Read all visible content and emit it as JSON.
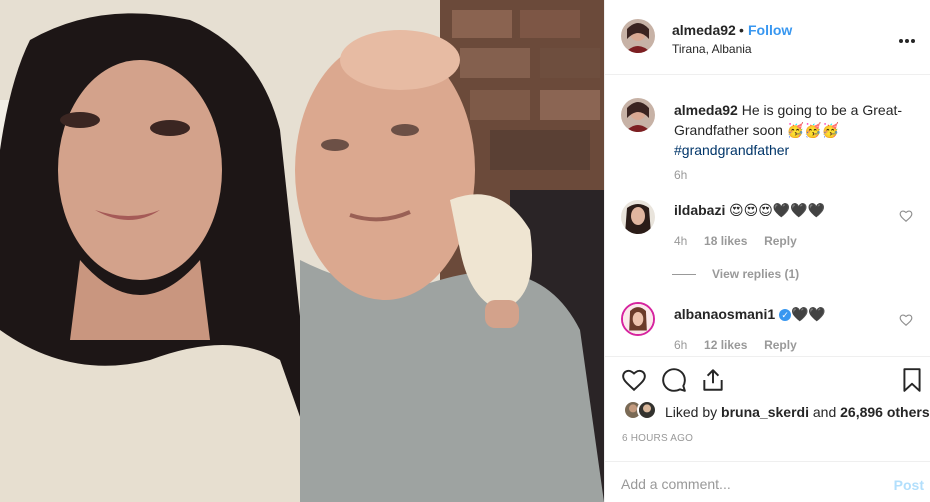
{
  "post": {
    "username": "almeda92",
    "dot": "•",
    "follow_label": "Follow",
    "location": "Tirana, Albania"
  },
  "caption": {
    "username": "almeda92",
    "text": "He is going to be a Great-Grandfather soon 🥳🥳🥳",
    "hashtag": "#grandgrandfather",
    "time": "6h"
  },
  "comments": [
    {
      "username": "ildabazi",
      "text": "😍😍😍🖤🖤🖤",
      "time": "4h",
      "likes": "18 likes",
      "reply": "Reply",
      "view_replies": "View replies (1)"
    },
    {
      "username": "albanaosmani1",
      "verified_mark": "✓",
      "text": "🖤🖤",
      "time": "6h",
      "likes": "12 likes",
      "reply": "Reply"
    }
  ],
  "likes": {
    "prefix": "Liked by",
    "user": "bruna_skerdi",
    "middle": "and",
    "count": "26,896 others"
  },
  "time_ago": "6 HOURS AGO",
  "add_comment": {
    "placeholder": "Add a comment...",
    "post_label": "Post"
  },
  "icons": {
    "more": "more-options-icon",
    "like": "heart-icon",
    "comment": "comment-bubble-icon",
    "share": "share-icon",
    "save": "bookmark-icon",
    "comment_like": "small-heart-icon",
    "verified": "verified-badge-icon"
  },
  "colors": {
    "link_blue": "#3897f0",
    "hashtag": "#003569",
    "muted": "#999999",
    "post_disabled": "#b2dffc"
  }
}
